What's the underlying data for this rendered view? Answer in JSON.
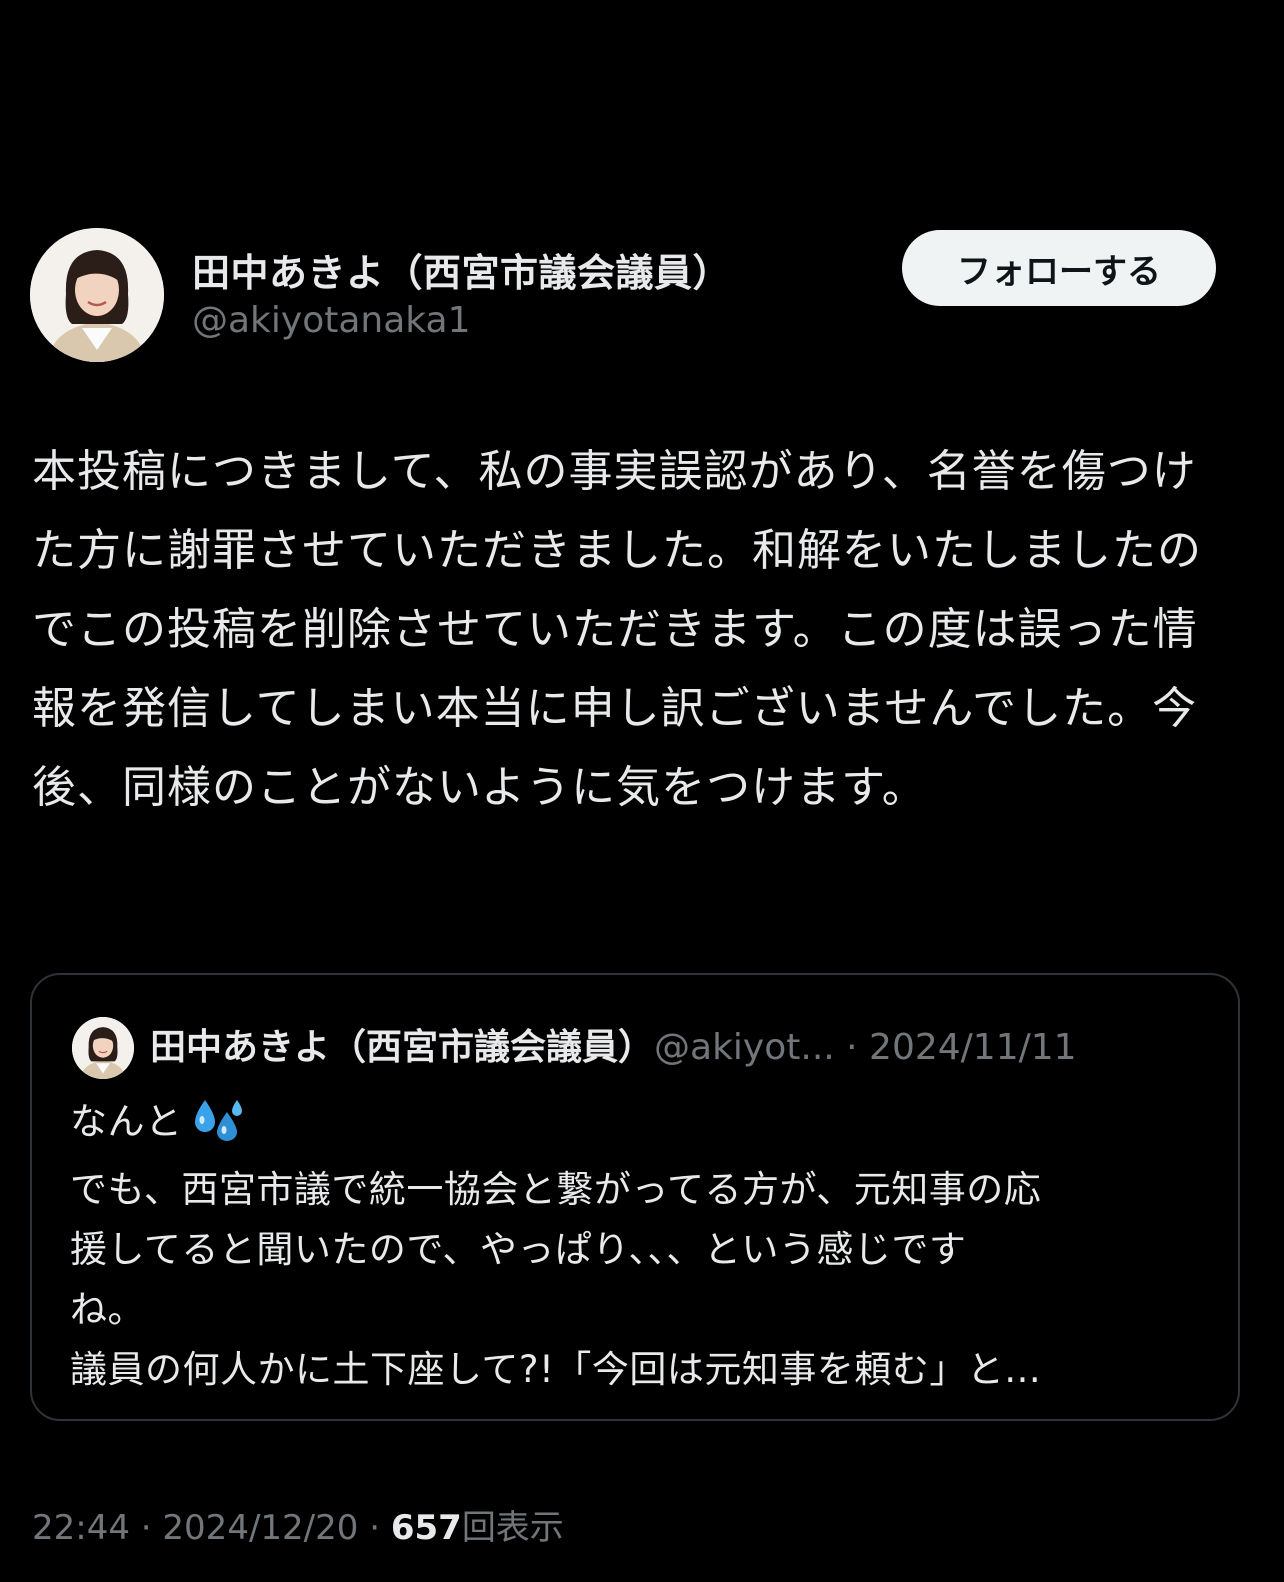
{
  "author": {
    "display_name": "田中あきよ（西宮市議会議員）",
    "handle": "@akiyotanaka1"
  },
  "follow_button": {
    "label": "フォローする"
  },
  "post": {
    "text": "本投稿につきまして、私の事実誤認があり、名誉を傷つけた方に謝罪させていただきました。和解をいたしましたのでこの投稿を削除させていただきます。この度は誤った情報を発信してしまい本当に申し訳ございませんでした。今後、同様のことがないように気をつけます。"
  },
  "quoted_post": {
    "display_name": "田中あきよ（西宮市議会議員）",
    "handle": "@akiyot...",
    "separator": " · ",
    "date": "2024/11/11",
    "lines": [
      "なんと",
      "でも、西宮市議で統一協会と繋がってる方が、元知事の応",
      "援してると聞いたので、やっぱり、、、という感じです",
      "ね。",
      "議員の何人かに土下座して?!「今回は元知事を頼む」と..."
    ],
    "emoji_icon": "sweat-droplets-icon"
  },
  "footer": {
    "time": "22:44",
    "separator": " · ",
    "date": "2024/12/20",
    "views_count": "657",
    "views_label": "回表示"
  },
  "colors": {
    "background": "#000000",
    "text": "#e7e9ea",
    "muted": "#71767b",
    "border": "#2f3336",
    "button_bg": "#eff3f4"
  }
}
